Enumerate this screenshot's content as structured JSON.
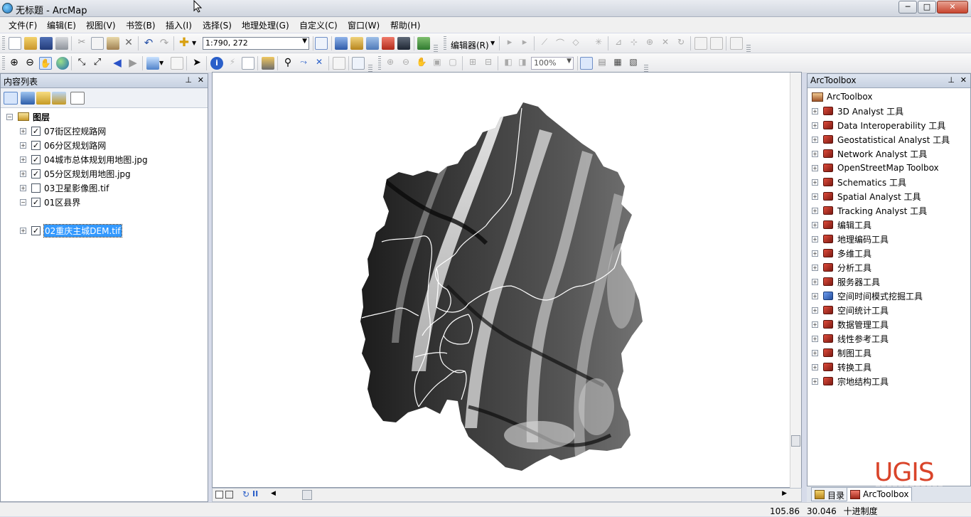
{
  "window": {
    "title": "无标题 - ArcMap",
    "minimize": "─",
    "maximize": "□",
    "close": "✕"
  },
  "menus": [
    "文件(F)",
    "编辑(E)",
    "视图(V)",
    "书签(B)",
    "插入(I)",
    "选择(S)",
    "地理处理(G)",
    "自定义(C)",
    "窗口(W)",
    "帮助(H)"
  ],
  "toolbar": {
    "scale": "1:790, 272",
    "editor": "编辑器(R)",
    "zoom_percent": "100%"
  },
  "toc": {
    "title": "内容列表",
    "root": "图层",
    "layers": [
      {
        "name": "07街区控规路网",
        "checked": true
      },
      {
        "name": "06分区规划路网",
        "checked": true
      },
      {
        "name": "04城市总体规划用地图.jpg",
        "checked": true
      },
      {
        "name": "05分区规划用地图.jpg",
        "checked": true
      },
      {
        "name": "03卫星影像图.tif",
        "checked": false
      },
      {
        "name": "01区县界",
        "checked": true
      },
      {
        "name": "02重庆主城DEM.tif",
        "checked": true,
        "selected": true
      }
    ]
  },
  "arctoolbox": {
    "title": "ArcToolbox",
    "root": "ArcToolbox",
    "items": [
      "3D Analyst 工具",
      "Data Interoperability 工具",
      "Geostatistical Analyst 工具",
      "Network Analyst 工具",
      "OpenStreetMap Toolbox",
      "Schematics 工具",
      "Spatial Analyst 工具",
      "Tracking Analyst 工具",
      "编辑工具",
      "地理编码工具",
      "多维工具",
      "分析工具",
      "服务器工具",
      "空间时间模式挖掘工具",
      "空间统计工具",
      "数据管理工具",
      "线性参考工具",
      "制图工具",
      "转换工具",
      "宗地结构工具"
    ],
    "blue_item": "空间时间模式挖掘工具"
  },
  "tabs": {
    "catalog": "目录",
    "arctoolbox": "ArcToolbox"
  },
  "status": {
    "x": "105.86",
    "y": "30.046",
    "units": "十进制度"
  },
  "watermark": {
    "brand": "UGIS"
  },
  "colors": {
    "selection": "#3399ff",
    "toolbox_red": "#c8342a",
    "panel_header": "#c7d1e1"
  }
}
